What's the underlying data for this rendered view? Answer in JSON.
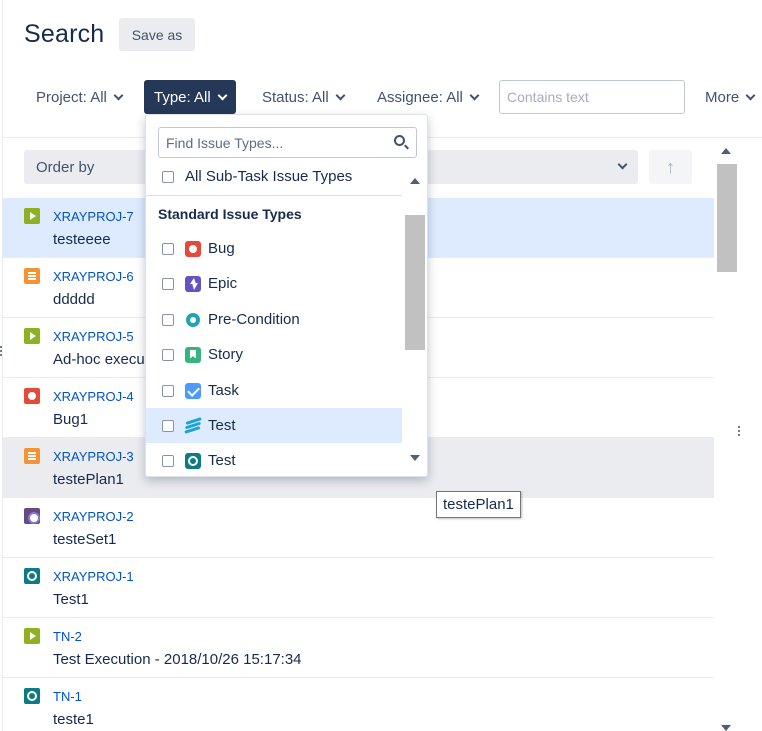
{
  "header": {
    "title": "Search",
    "save_as_label": "Save as"
  },
  "filters": {
    "project": "Project: All",
    "type": "Type: All",
    "status": "Status: All",
    "assignee": "Assignee: All",
    "text_placeholder": "Contains text",
    "more": "More"
  },
  "order": {
    "label": "Order by",
    "sort_icon": "arrow-up-icon"
  },
  "issues": [
    {
      "key": "XRAYPROJ-7",
      "summary": "testeeee",
      "type_icon": "test-execution-icon"
    },
    {
      "key": "XRAYPROJ-6",
      "summary": "ddddd",
      "type_icon": "test-plan-icon"
    },
    {
      "key": "XRAYPROJ-5",
      "summary": "Ad-hoc execu",
      "type_icon": "test-execution-icon"
    },
    {
      "key": "XRAYPROJ-4",
      "summary": "Bug1",
      "type_icon": "bug-icon"
    },
    {
      "key": "XRAYPROJ-3",
      "summary": "testePlan1",
      "type_icon": "test-plan-icon"
    },
    {
      "key": "XRAYPROJ-2",
      "summary": "testeSet1",
      "type_icon": "test-set-icon"
    },
    {
      "key": "XRAYPROJ-1",
      "summary": "Test1",
      "type_icon": "test-icon"
    },
    {
      "key": "TN-2",
      "summary": "Test Execution - 2018/10/26 15:17:34",
      "type_icon": "test-execution-icon"
    },
    {
      "key": "TN-1",
      "summary": "teste1",
      "type_icon": "test-icon"
    }
  ],
  "tooltip": "testePlan1",
  "type_dropdown": {
    "search_placeholder": "Find Issue Types...",
    "subtask_option": "All Sub-Task Issue Types",
    "section_heading": "Standard Issue Types",
    "options": [
      {
        "label": "Bug",
        "icon": "bug-icon"
      },
      {
        "label": "Epic",
        "icon": "epic-icon"
      },
      {
        "label": "Pre-Condition",
        "icon": "pre-condition-icon"
      },
      {
        "label": "Story",
        "icon": "story-icon"
      },
      {
        "label": "Task",
        "icon": "task-icon"
      },
      {
        "label": "Test",
        "icon": "xray-test-icon"
      },
      {
        "label": "Test",
        "icon": "test-icon"
      }
    ]
  },
  "colors": {
    "active_filter_bg": "#253858",
    "link": "#0052CC",
    "selected_row": "#DEEBFF"
  }
}
